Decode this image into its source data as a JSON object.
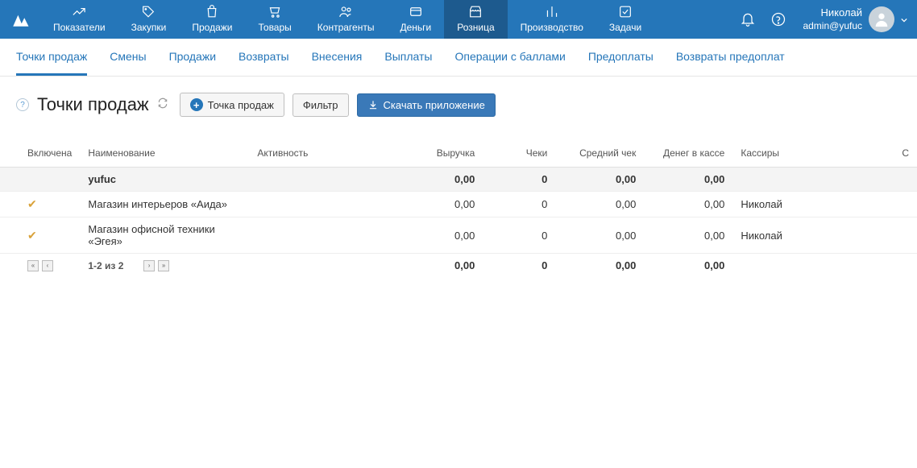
{
  "nav": {
    "items": [
      {
        "label": "Показатели"
      },
      {
        "label": "Закупки"
      },
      {
        "label": "Продажи"
      },
      {
        "label": "Товары"
      },
      {
        "label": "Контрагенты"
      },
      {
        "label": "Деньги"
      },
      {
        "label": "Розница"
      },
      {
        "label": "Производство"
      },
      {
        "label": "Задачи"
      }
    ],
    "activeIndex": 6,
    "user": {
      "name": "Николай",
      "login": "admin@yufuc"
    }
  },
  "subtabs": {
    "items": [
      {
        "label": "Точки продаж"
      },
      {
        "label": "Смены"
      },
      {
        "label": "Продажи"
      },
      {
        "label": "Возвраты"
      },
      {
        "label": "Внесения"
      },
      {
        "label": "Выплаты"
      },
      {
        "label": "Операции с баллами"
      },
      {
        "label": "Предоплаты"
      },
      {
        "label": "Возвраты предоплат"
      }
    ],
    "activeIndex": 0
  },
  "page": {
    "title": "Точки продаж",
    "addButton": "Точка продаж",
    "filterButton": "Фильтр",
    "downloadButton": "Скачать приложение"
  },
  "table": {
    "headers": {
      "enabled": "Включена",
      "name": "Наименование",
      "activity": "Активность",
      "revenue": "Выручка",
      "receipts": "Чеки",
      "avgCheck": "Средний чек",
      "cash": "Денег в кассе",
      "cashiers": "Кассиры",
      "schedule": "С"
    },
    "group": {
      "name": "yufuc",
      "revenue": "0,00",
      "receipts": "0",
      "avgCheck": "0,00",
      "cash": "0,00"
    },
    "rows": [
      {
        "enabled": true,
        "name": "Магазин интерьеров «Аида»",
        "revenue": "0,00",
        "receipts": "0",
        "avgCheck": "0,00",
        "cash": "0,00",
        "cashiers": "Николай"
      },
      {
        "enabled": true,
        "name": "Магазин офисной техники «Эгея»",
        "revenue": "0,00",
        "receipts": "0",
        "avgCheck": "0,00",
        "cash": "0,00",
        "cashiers": "Николай"
      }
    ],
    "footer": {
      "pagination": "1-2 из 2",
      "revenue": "0,00",
      "receipts": "0",
      "avgCheck": "0,00",
      "cash": "0,00"
    }
  }
}
